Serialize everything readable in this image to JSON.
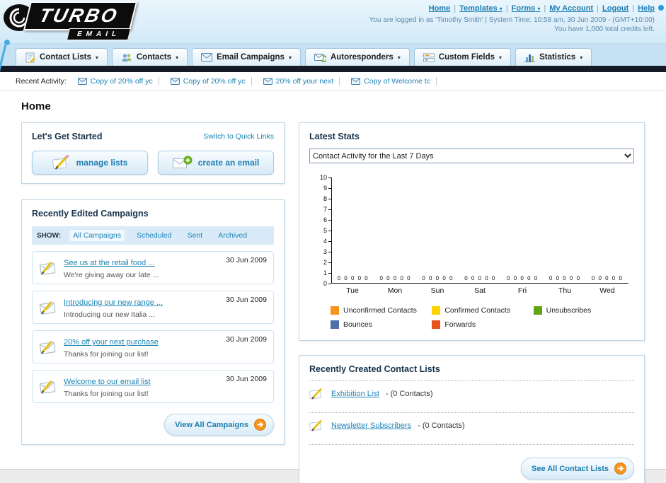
{
  "colors": {
    "accent_teal": "#1d7db1",
    "orange": "#f7941d",
    "dark_bar": "#141a26"
  },
  "glyphs": {
    "caret": "▾",
    "pipe": "|"
  },
  "header": {
    "logo_title": "TURBO",
    "logo_subtitle": "EMAIL",
    "nav_links": [
      {
        "label": "Home",
        "dropdown": false
      },
      {
        "label": "Templates",
        "dropdown": true
      },
      {
        "label": "Forms",
        "dropdown": true
      },
      {
        "label": "My Account",
        "dropdown": false
      },
      {
        "label": "Logout",
        "dropdown": false
      },
      {
        "label": "Help",
        "dropdown": false
      }
    ],
    "login_status": "You are logged in as 'Timothy Smith' | System Time: 10:58 am, 30 Jun 2009 - (GMT+10:00)",
    "credits_note": "You have 1,000 total credits left."
  },
  "nav_tabs": [
    {
      "label": "Contact Lists"
    },
    {
      "label": "Contacts"
    },
    {
      "label": "Email Campaigns"
    },
    {
      "label": "Autoresponders"
    },
    {
      "label": "Custom Fields"
    },
    {
      "label": "Statistics"
    }
  ],
  "recent_activity": {
    "label": "Recent Activity:",
    "items": [
      "Copy of 20% off yc",
      "Copy of 20% off yc",
      "20% off your next",
      "Copy of Welcome tc"
    ]
  },
  "page_title": "Home",
  "get_started": {
    "title": "Let's Get Started",
    "switch_link": "Switch to Quick Links",
    "manage_lists_label": "manage lists",
    "create_email_label": "create an email"
  },
  "campaigns": {
    "title": "Recently Edited Campaigns",
    "show_label": "SHOW:",
    "filters": [
      "All Campaigns",
      "Scheduled",
      "Sent",
      "Archived"
    ],
    "active_filter": "All Campaigns",
    "items": [
      {
        "title": "See us at the retail food ...",
        "subtitle": "We're giving away our late ...",
        "date": "30 Jun 2009"
      },
      {
        "title": "Introducing our new range ...",
        "subtitle": "Introducing our new Italia ...",
        "date": "30 Jun 2009"
      },
      {
        "title": "20% off your next purchase",
        "subtitle": "Thanks for joining our list!",
        "date": "30 Jun 2009"
      },
      {
        "title": "Welcome to our email list",
        "subtitle": "Thanks for joining our list!",
        "date": "30 Jun 2009"
      }
    ],
    "view_all_label": "View All Campaigns"
  },
  "stats": {
    "title": "Latest Stats",
    "range_selected": "Contact Activity for the Last 7 Days",
    "legend": [
      {
        "label": "Unconfirmed Contacts",
        "color": "#f7941d"
      },
      {
        "label": "Confirmed Contacts",
        "color": "#ffd200"
      },
      {
        "label": "Unsubscribes",
        "color": "#61a517"
      },
      {
        "label": "Bounces",
        "color": "#4f6fa8"
      },
      {
        "label": "Forwards",
        "color": "#e8541d"
      }
    ]
  },
  "chart_data": {
    "type": "bar",
    "title": "Contact Activity for the Last 7 Days",
    "categories": [
      "Tue",
      "Mon",
      "Sun",
      "Sat",
      "Fri",
      "Thu",
      "Wed"
    ],
    "series": [
      {
        "name": "Unconfirmed Contacts",
        "values": [
          0,
          0,
          0,
          0,
          0,
          0,
          0
        ]
      },
      {
        "name": "Confirmed Contacts",
        "values": [
          0,
          0,
          0,
          0,
          0,
          0,
          0
        ]
      },
      {
        "name": "Unsubscribes",
        "values": [
          0,
          0,
          0,
          0,
          0,
          0,
          0
        ]
      },
      {
        "name": "Bounces",
        "values": [
          0,
          0,
          0,
          0,
          0,
          0,
          0
        ]
      },
      {
        "name": "Forwards",
        "values": [
          0,
          0,
          0,
          0,
          0,
          0,
          0
        ]
      }
    ],
    "ylim": [
      0,
      10
    ],
    "yticks": [
      0,
      1,
      2,
      3,
      4,
      5,
      6,
      7,
      8,
      9,
      10
    ],
    "grid": false,
    "legend_position": "bottom"
  },
  "contact_lists": {
    "title": "Recently Created Contact Lists",
    "items": [
      {
        "name": "Exhibition List",
        "detail": "- (0 Contacts)"
      },
      {
        "name": "Newsletter Subscribers",
        "detail": "- (0 Contacts)"
      }
    ],
    "see_all_label": "See All Contact Lists"
  }
}
